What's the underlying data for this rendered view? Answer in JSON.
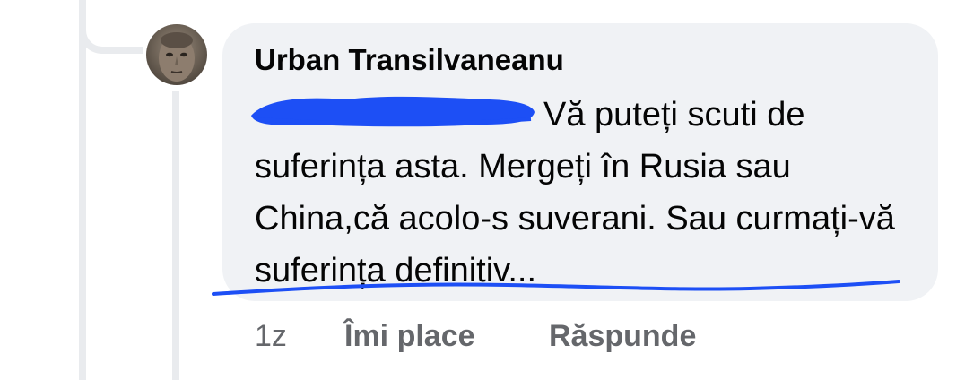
{
  "comment": {
    "author": "Urban Transilvaneanu",
    "text": "Vă puteți scuti de suferința asta. Mergeți în Rusia sau China,că acolo-s suverani. Sau curmați-vă suferința definitiv..."
  },
  "actions": {
    "time": "1z",
    "like_label": "Îmi place",
    "reply_label": "Răspunde"
  },
  "annotations": {
    "redaction_color": "#1d4ff5",
    "underline_color": "#1d4ff5"
  },
  "colors": {
    "bubble_bg": "#f0f2f5",
    "text": "#050505",
    "secondary_text": "#65676b",
    "thread_line": "#e9ebee"
  }
}
